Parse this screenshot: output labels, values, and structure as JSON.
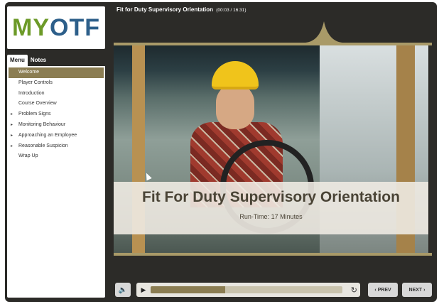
{
  "app": {
    "logo_text_left": "MY",
    "logo_text_right": "OTF",
    "title": "Fit for Duty Supervisory Orientation",
    "time": "(00:03 / 16:31)"
  },
  "sidebar": {
    "tabs": [
      {
        "label": "Menu",
        "active": true
      },
      {
        "label": "Notes",
        "active": false
      }
    ],
    "items": [
      {
        "label": "Welcome",
        "active": true,
        "expandable": false
      },
      {
        "label": "Player Controls",
        "active": false,
        "expandable": false
      },
      {
        "label": "Introduction",
        "active": false,
        "expandable": false
      },
      {
        "label": "Course Overview",
        "active": false,
        "expandable": false
      },
      {
        "label": "Problem Signs",
        "active": false,
        "expandable": true
      },
      {
        "label": "Monitoring Behaviour",
        "active": false,
        "expandable": true
      },
      {
        "label": "Approaching an Employee",
        "active": false,
        "expandable": true
      },
      {
        "label": "Reasonable Suspicion",
        "active": false,
        "expandable": true
      },
      {
        "label": "Wrap Up",
        "active": false,
        "expandable": false
      }
    ]
  },
  "slide": {
    "heading": "Fit For Duty Supervisory Orientation",
    "subheading": "Run-Time: 17 Minutes"
  },
  "player": {
    "progress": 0.39,
    "mute_icon": "speaker-icon",
    "play_icon": "play-icon",
    "replay_icon": "replay-icon"
  },
  "nav": {
    "prev_label": "‹ PREV",
    "next_label": "NEXT ›"
  },
  "colors": {
    "frame": "#2c2b28",
    "accent": "#8b7d52",
    "logo_green": "#6c9a28",
    "logo_blue": "#2d5f8a"
  }
}
